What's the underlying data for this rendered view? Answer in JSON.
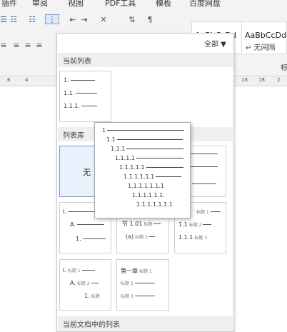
{
  "menu": {
    "items": [
      "插件",
      "审阅",
      "视图",
      "PDF工具",
      "模板",
      "百度网盘"
    ]
  },
  "ribbon": {
    "style_samples": [
      {
        "sample": "AaBbCcDd"
      },
      {
        "sample": "AaBbCcDd"
      }
    ],
    "style_label_2": "↵ 无间隔",
    "partial_label": "标",
    "ruler_numbers": [
      "6",
      "4",
      "16",
      "18",
      "2"
    ]
  },
  "dropdown": {
    "filter": "全部 ▼",
    "current_list_header": "当前列表",
    "current_list_lines": [
      "1.",
      "1.1.",
      "1.1.1."
    ],
    "library_header": "列表库",
    "none_label": "无",
    "doc_lists_header": "当前文档中的列表",
    "popup_lines": [
      "1",
      "1.1",
      "1.1.1",
      "1.1.1.1",
      "1.1.1.1.1",
      "1.1.1.1.1.1",
      "1.1.1.1.1.1.1",
      "1.1.1.1.1.1.",
      "1.1.1.1.1.1.1"
    ],
    "thumb_roman": [
      "I.",
      "A.",
      "1."
    ],
    "thumb_section": [
      "节 1.01",
      "标题",
      "(a)",
      "标题 3"
    ],
    "thumb_heading": [
      "标题 1",
      "1.1",
      "标题 2",
      "1.1.1",
      "标题 3"
    ],
    "thumb_roman_heading": [
      "I.",
      "标题 1",
      "A.",
      "标题 2",
      "1.",
      "标题"
    ],
    "thumb_chapter": [
      "第一章",
      "标题 1",
      "标题 2",
      "标题 3"
    ]
  }
}
